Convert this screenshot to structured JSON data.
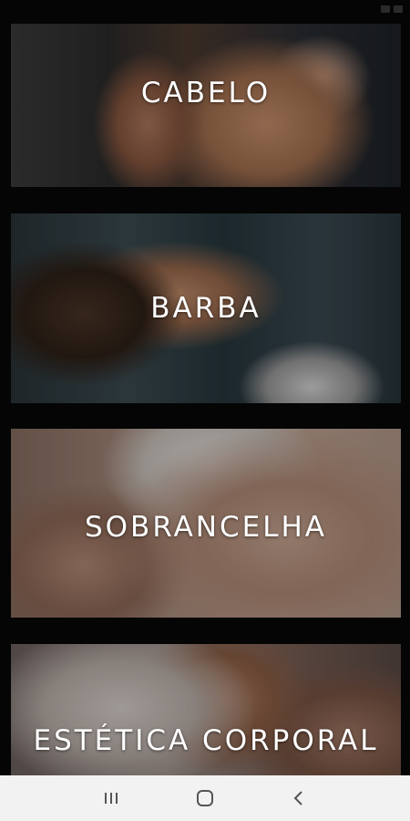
{
  "services": [
    {
      "label": "CABELO"
    },
    {
      "label": "BARBA"
    },
    {
      "label": "SOBRANCELHA"
    },
    {
      "label": "ESTÉTICA CORPORAL"
    }
  ],
  "colors": {
    "background": "#050505",
    "label_text": "#ffffff",
    "navbar": "#f2f2f2",
    "nav_icon": "#555555"
  },
  "navbar": {
    "icons": [
      "recent-apps-icon",
      "home-icon",
      "back-icon"
    ]
  }
}
